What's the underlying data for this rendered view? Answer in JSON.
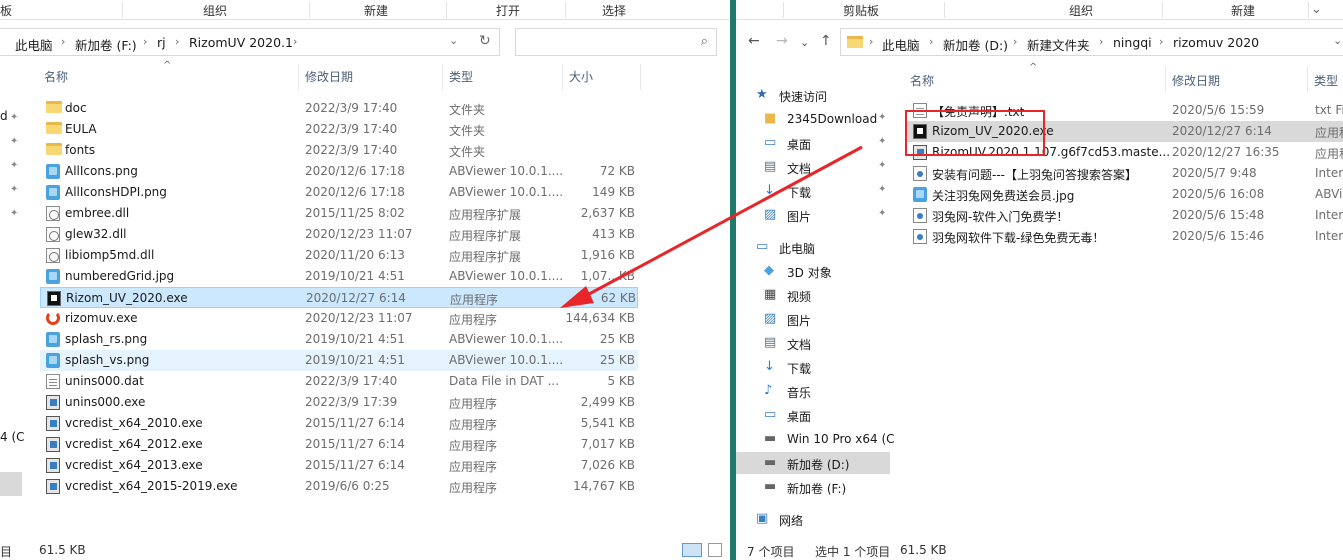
{
  "left": {
    "ribbon": [
      "板",
      "组织",
      "新建",
      "打开",
      "选择"
    ],
    "address": [
      "此电脑",
      "新加卷 (F:)",
      "rj",
      "RizomUV 2020.1"
    ],
    "columns": {
      "name": "名称",
      "date": "修改日期",
      "type": "类型",
      "size": "大小"
    },
    "files": [
      {
        "name": "doc",
        "date": "2022/3/9 17:40",
        "type": "文件夹",
        "size": "",
        "icon": "folder"
      },
      {
        "name": "EULA",
        "date": "2022/3/9 17:40",
        "type": "文件夹",
        "size": "",
        "icon": "folder"
      },
      {
        "name": "fonts",
        "date": "2022/3/9 17:40",
        "type": "文件夹",
        "size": "",
        "icon": "folder"
      },
      {
        "name": "AllIcons.png",
        "date": "2020/12/6 17:18",
        "type": "ABViewer 10.0.1....",
        "size": "72 KB",
        "icon": "png"
      },
      {
        "name": "AllIconsHDPI.png",
        "date": "2020/12/6 17:18",
        "type": "ABViewer 10.0.1....",
        "size": "149 KB",
        "icon": "png"
      },
      {
        "name": "embree.dll",
        "date": "2015/11/25 8:02",
        "type": "应用程序扩展",
        "size": "2,637 KB",
        "icon": "dll"
      },
      {
        "name": "glew32.dll",
        "date": "2020/12/23 11:07",
        "type": "应用程序扩展",
        "size": "413 KB",
        "icon": "dll"
      },
      {
        "name": "libiomp5md.dll",
        "date": "2020/11/20 6:13",
        "type": "应用程序扩展",
        "size": "1,916 KB",
        "icon": "dll"
      },
      {
        "name": "numberedGrid.jpg",
        "date": "2019/10/21 4:51",
        "type": "ABViewer 10.0.1....",
        "size": "1,07.. KB",
        "icon": "png"
      },
      {
        "name": "Rizom_UV_2020.exe",
        "date": "2020/12/27 6:14",
        "type": "应用程序",
        "size": "62 KB",
        "icon": "rizom",
        "state": "sel"
      },
      {
        "name": "rizomuv.exe",
        "date": "2020/12/23 11:07",
        "type": "应用程序",
        "size": "144,634 KB",
        "icon": "uv"
      },
      {
        "name": "splash_rs.png",
        "date": "2019/10/21 4:51",
        "type": "ABViewer 10.0.1....",
        "size": "25 KB",
        "icon": "png"
      },
      {
        "name": "splash_vs.png",
        "date": "2019/10/21 4:51",
        "type": "ABViewer 10.0.1....",
        "size": "25 KB",
        "icon": "png",
        "state": "hover"
      },
      {
        "name": "unins000.dat",
        "date": "2022/3/9 17:40",
        "type": "Data File in DAT ...",
        "size": "5 KB",
        "icon": "dat"
      },
      {
        "name": "unins000.exe",
        "date": "2022/3/9 17:39",
        "type": "应用程序",
        "size": "2,499 KB",
        "icon": "exe"
      },
      {
        "name": "vcredist_x64_2010.exe",
        "date": "2015/11/27 6:14",
        "type": "应用程序",
        "size": "5,541 KB",
        "icon": "exe"
      },
      {
        "name": "vcredist_x64_2012.exe",
        "date": "2015/11/27 6:14",
        "type": "应用程序",
        "size": "7,017 KB",
        "icon": "exe"
      },
      {
        "name": "vcredist_x64_2013.exe",
        "date": "2015/11/27 6:14",
        "type": "应用程序",
        "size": "7,026 KB",
        "icon": "exe"
      },
      {
        "name": "vcredist_x64_2015-2019.exe",
        "date": "2019/6/6 0:25",
        "type": "应用程序",
        "size": "14,767 KB",
        "icon": "exe"
      }
    ],
    "nav_fragments": [
      "d",
      "4 (C"
    ],
    "status": {
      "count": "目",
      "size": "61.5 KB"
    }
  },
  "right": {
    "ribbon": [
      "剪贴板",
      "组织",
      "新建"
    ],
    "address": [
      "此电脑",
      "新加卷 (D:)",
      "新建文件夹",
      "ningqi",
      "rizomuv 2020"
    ],
    "columns": {
      "name": "名称",
      "date": "修改日期",
      "type": "类型"
    },
    "nav": [
      {
        "label": "快速访问",
        "icon": "star",
        "indent": 0
      },
      {
        "label": "2345Download",
        "icon": "folder",
        "indent": 1,
        "pin": true
      },
      {
        "label": "桌面",
        "icon": "desktop",
        "indent": 1,
        "pin": true
      },
      {
        "label": "文档",
        "icon": "doc",
        "indent": 1,
        "pin": true
      },
      {
        "label": "下载",
        "icon": "download",
        "indent": 1,
        "pin": true
      },
      {
        "label": "图片",
        "icon": "pictures",
        "indent": 1,
        "pin": true
      },
      {
        "label": "此电脑",
        "icon": "pc",
        "indent": 0
      },
      {
        "label": "3D 对象",
        "icon": "cube",
        "indent": 1
      },
      {
        "label": "视频",
        "icon": "video",
        "indent": 1
      },
      {
        "label": "图片",
        "icon": "pictures",
        "indent": 1
      },
      {
        "label": "文档",
        "icon": "doc",
        "indent": 1
      },
      {
        "label": "下载",
        "icon": "download",
        "indent": 1
      },
      {
        "label": "音乐",
        "icon": "music",
        "indent": 1
      },
      {
        "label": "桌面",
        "icon": "desktop",
        "indent": 1
      },
      {
        "label": "Win 10 Pro x64 (C",
        "icon": "drive",
        "indent": 1
      },
      {
        "label": "新加卷 (D:)",
        "icon": "drive",
        "indent": 1,
        "sel": true
      },
      {
        "label": "新加卷 (F:)",
        "icon": "drive",
        "indent": 1
      },
      {
        "label": "网络",
        "icon": "network",
        "indent": 0
      }
    ],
    "files": [
      {
        "name": "【免责声明】.txt",
        "date": "2020/5/6 15:59",
        "type": "txt Fi",
        "icon": "txt"
      },
      {
        "name": "Rizom_UV_2020.exe",
        "date": "2020/12/27 6:14",
        "type": "应用程",
        "icon": "rizom",
        "state": "gray"
      },
      {
        "name": "RizomUV.2020.1.107.g6f7cd53.maste...",
        "date": "2020/12/27 16:35",
        "type": "应用程",
        "icon": "exe"
      },
      {
        "name": "安装有问题---【上羽兔问答搜索答案】",
        "date": "2020/5/7 9:48",
        "type": "Intern",
        "icon": "url"
      },
      {
        "name": "关注羽兔网免费送会员.jpg",
        "date": "2020/5/6 16:08",
        "type": "ABVi",
        "icon": "png"
      },
      {
        "name": "羽兔网-软件入门免费学！",
        "date": "2020/5/6 15:48",
        "type": "Intern",
        "icon": "url"
      },
      {
        "name": "羽兔网软件下载-绿色免费无毒！",
        "date": "2020/5/6 15:46",
        "type": "Intern",
        "icon": "url"
      }
    ],
    "status": {
      "count": "7 个项目",
      "selected": "选中 1 个项目",
      "size": "61.5 KB"
    }
  },
  "colors": {
    "accent": "#1f7a6e",
    "selection": "#cce8ff",
    "highlight": "#e8262a"
  }
}
